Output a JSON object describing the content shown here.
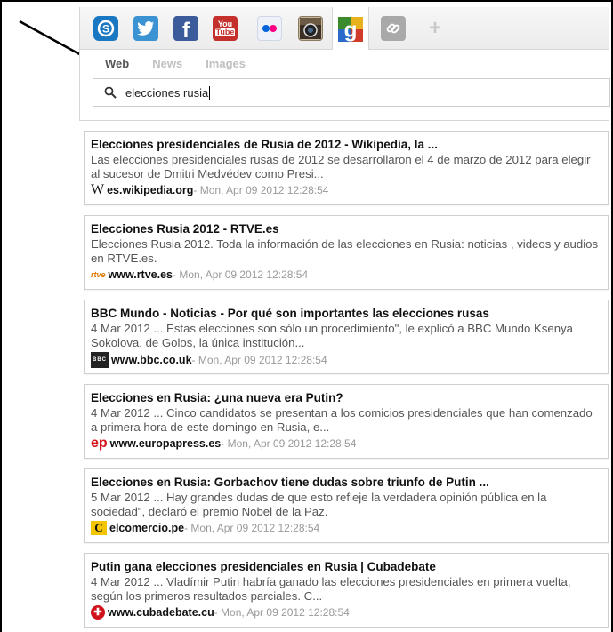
{
  "services": [
    {
      "name": "skype-icon",
      "glyph": "S",
      "color": "#1a78c2"
    },
    {
      "name": "twitter-icon",
      "glyph": "t",
      "color": "#3c93d4"
    },
    {
      "name": "facebook-icon",
      "glyph": "f",
      "color": "#3b5b9a"
    },
    {
      "name": "youtube-icon",
      "glyph": "You",
      "color": "#c4302b"
    },
    {
      "name": "flickr-icon",
      "glyph": "••",
      "color": "#eef1f8"
    },
    {
      "name": "instagram-icon",
      "glyph": "◉",
      "color": "#5b4a3a"
    },
    {
      "name": "google-icon",
      "glyph": "g",
      "color": "#4c8c2f"
    },
    {
      "name": "link-icon",
      "glyph": "∞",
      "color": "#9a9a9a"
    },
    {
      "name": "add-tab-icon",
      "glyph": "+",
      "color": "#c8c8c8"
    }
  ],
  "subtabs": [
    {
      "label": "Web",
      "active": true
    },
    {
      "label": "News",
      "active": false
    },
    {
      "label": "Images",
      "active": false
    }
  ],
  "search": {
    "value": "elecciones rusia"
  },
  "results": [
    {
      "title": "Elecciones presidenciales de Rusia de 2012 - Wikipedia, la ...",
      "snippet": "Las elecciones presidenciales rusas de 2012 se desarrollaron el 4 de marzo de 2012 para elegir al sucesor de Dmitri Medvédev como Presi...",
      "favicon": "W",
      "domain": "es.wikipedia.org",
      "timestamp": " - Mon, Apr 09 2012 12:28:54"
    },
    {
      "title": "Elecciones Rusia 2012 - RTVE.es",
      "snippet": "Elecciones Rusia 2012. Toda la información de las elecciones en Rusia: noticias , videos y audios en RTVE.es.",
      "favicon": "rtve",
      "domain": "www.rtve.es",
      "timestamp": " - Mon, Apr 09 2012 12:28:54"
    },
    {
      "title": "BBC Mundo - Noticias - Por qué son importantes las elecciones rusas",
      "snippet": "4 Mar 2012 ... Estas elecciones son sólo un procedimiento\", le explicó a BBC Mundo Ksenya Sokolova, de Golos, la única institución...",
      "favicon": "BBC",
      "domain": "www.bbc.co.uk",
      "timestamp": " - Mon, Apr 09 2012 12:28:54"
    },
    {
      "title": "Elecciones en Rusia: ¿una nueva era Putin?",
      "snippet": "4 Mar 2012 ... Cinco candidatos se presentan a los comicios presidenciales que han comenzado a primera hora de este domingo en Rusia, e...",
      "favicon": "ep",
      "domain": "www.europapress.es",
      "timestamp": " - Mon, Apr 09 2012 12:28:54"
    },
    {
      "title": "Elecciones en Rusia: Gorbachov tiene dudas sobre triunfo de Putin ...",
      "snippet": "5 Mar 2012 ... Hay grandes dudas de que esto refleje la verdadera opinión pública en la sociedad\", declaró el premio Nobel de la Paz.",
      "favicon": "C",
      "domain": "elcomercio.pe",
      "timestamp": " - Mon, Apr 09 2012 12:28:54"
    },
    {
      "title": "Putin gana elecciones presidenciales en Rusia | Cubadebate",
      "snippet": "4 Mar 2012 ... Vladímir Putin habría ganado las elecciones presidenciales en primera vuelta, según los primeros resultados parciales. C...",
      "favicon": "✚",
      "domain": "www.cubadebate.cu",
      "timestamp": " - Mon, Apr 09 2012 12:28:54"
    }
  ]
}
